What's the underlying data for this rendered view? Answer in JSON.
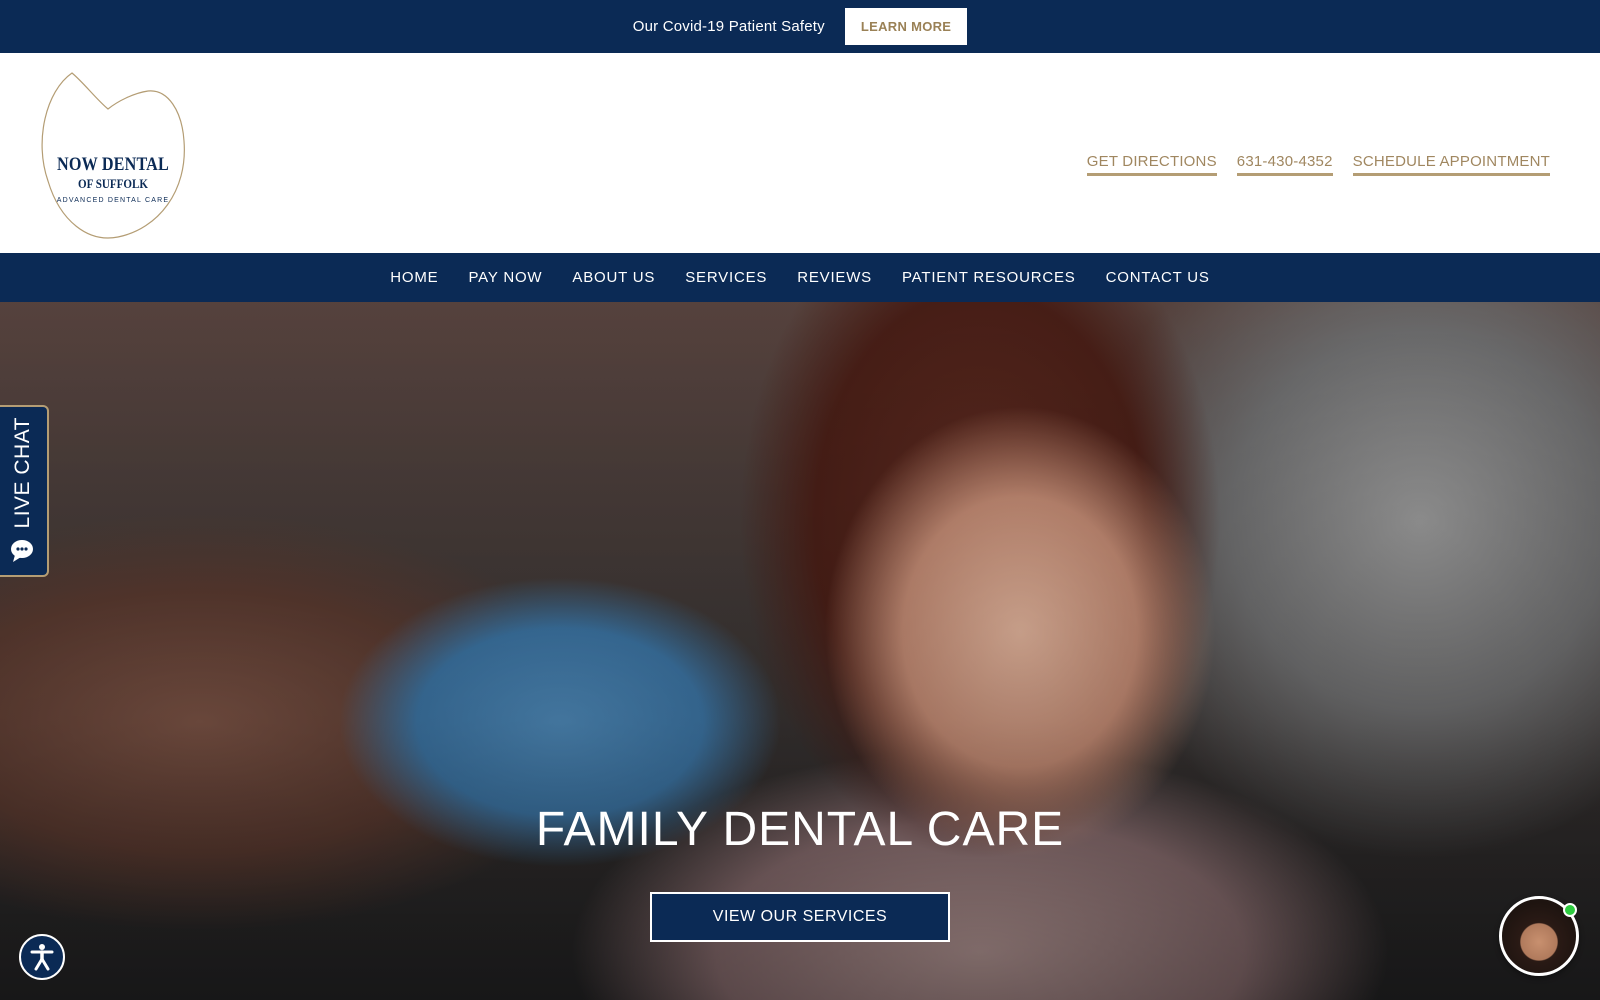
{
  "topbar": {
    "text": "Our Covid-19 Patient Safety",
    "button_label": "LEARN MORE"
  },
  "logo": {
    "line1": "NOW DENTAL",
    "line2": "OF SUFFOLK",
    "line3": "ADVANCED DENTAL CARE"
  },
  "header_links": {
    "directions": "GET DIRECTIONS",
    "phone": "631-430-4352",
    "schedule": "SCHEDULE APPOINTMENT"
  },
  "nav": {
    "items": [
      "HOME",
      "PAY NOW",
      "ABOUT US",
      "SERVICES",
      "REVIEWS",
      "PATIENT RESOURCES",
      "CONTACT US"
    ]
  },
  "hero": {
    "title": "FAMILY DENTAL CARE",
    "button_label": "VIEW OUR SERVICES"
  },
  "livechat": {
    "label": "LIVE CHAT",
    "icon": "chat-bubble-icon"
  },
  "widgets": {
    "accessibility_icon": "accessibility-icon",
    "chat_avatar": "chat-avatar",
    "online_status": "online"
  },
  "colors": {
    "navy": "#0b2a55",
    "gold": "#a08760",
    "white": "#ffffff"
  }
}
